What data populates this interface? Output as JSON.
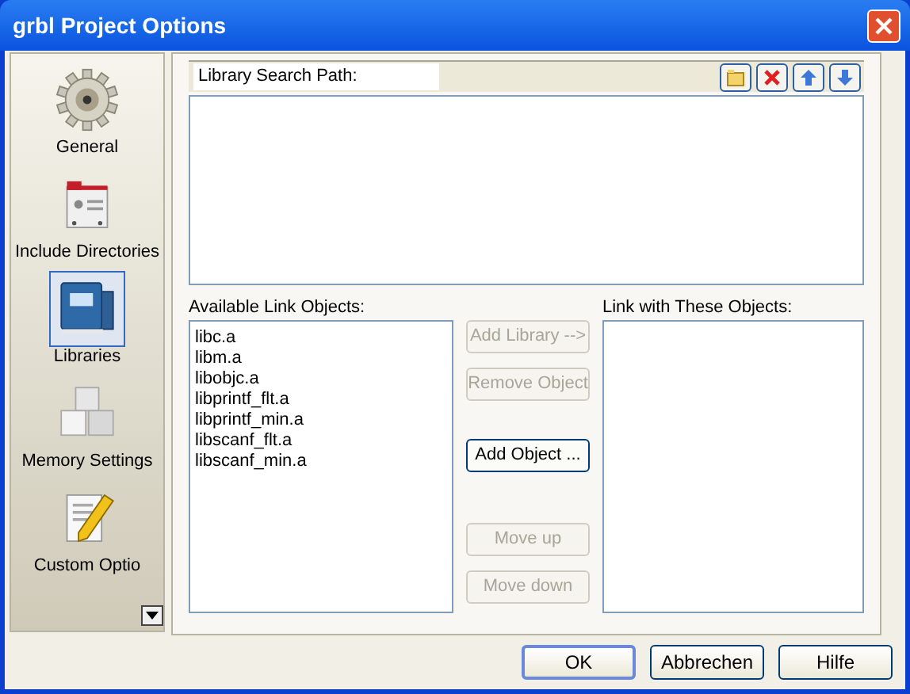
{
  "window": {
    "title": "grbl Project Options"
  },
  "sidebar": {
    "items": [
      {
        "label": "General",
        "kind": "gear",
        "selected": false
      },
      {
        "label": "Include Directories",
        "kind": "card",
        "selected": false
      },
      {
        "label": "Libraries",
        "kind": "books",
        "selected": true
      },
      {
        "label": "Memory Settings",
        "kind": "cubes",
        "selected": false
      },
      {
        "label": "Custom Optio",
        "kind": "notepad",
        "selected": false
      }
    ]
  },
  "search_path": {
    "label": "Library Search Path:",
    "tools": [
      {
        "kind": "folder"
      },
      {
        "kind": "delete"
      },
      {
        "kind": "up"
      },
      {
        "kind": "down"
      }
    ]
  },
  "available": {
    "label": "Available Link Objects:",
    "items": [
      "libc.a",
      "libm.a",
      "libobjc.a",
      "libprintf_flt.a",
      "libprintf_min.a",
      "libscanf_flt.a",
      "libscanf_min.a"
    ]
  },
  "actions": [
    {
      "label": "Add Library -->",
      "disabled": true
    },
    {
      "label": "Remove Object",
      "disabled": true
    },
    {
      "label": "Add Object ...",
      "disabled": false
    },
    {
      "label": "Move up",
      "disabled": true
    },
    {
      "label": "Move down",
      "disabled": true
    }
  ],
  "linked": {
    "label": "Link with These Objects:"
  },
  "footer": [
    {
      "label": "OK",
      "default": true
    },
    {
      "label": "Abbrechen",
      "default": false
    },
    {
      "label": "Hilfe",
      "default": false
    }
  ]
}
